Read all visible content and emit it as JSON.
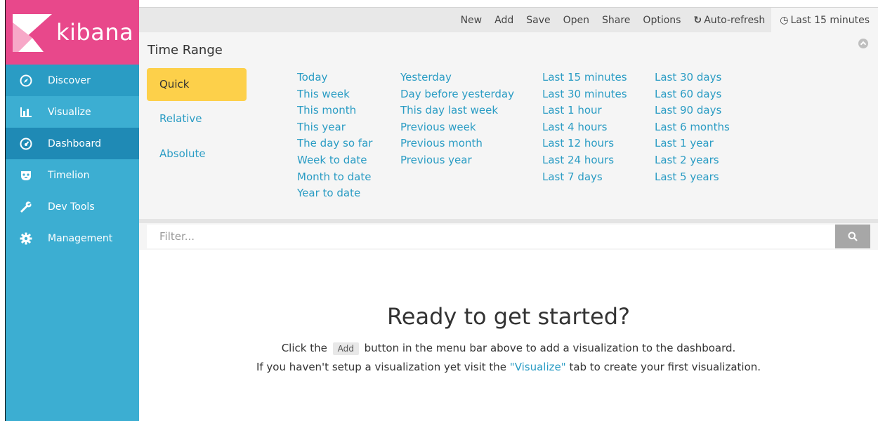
{
  "app": {
    "name": "kibana",
    "brand_color": "#e8488b",
    "sidebar_color": "#3caed2"
  },
  "sidebar": {
    "items": [
      {
        "label": "Discover",
        "icon": "compass-icon"
      },
      {
        "label": "Visualize",
        "icon": "bar-chart-icon"
      },
      {
        "label": "Dashboard",
        "icon": "dashboard-gauge-icon"
      },
      {
        "label": "Timelion",
        "icon": "timelion-mask-icon"
      },
      {
        "label": "Dev Tools",
        "icon": "wrench-icon"
      },
      {
        "label": "Management",
        "icon": "gear-icon"
      }
    ]
  },
  "topbar": {
    "new": "New",
    "add": "Add",
    "save": "Save",
    "open": "Open",
    "share": "Share",
    "options": "Options",
    "auto_refresh": "Auto-refresh",
    "time": "Last 15 minutes"
  },
  "time_panel": {
    "title": "Time Range",
    "tabs": [
      "Quick",
      "Relative",
      "Absolute"
    ],
    "active_tab": "Quick",
    "accent_color": "#fdd04a",
    "columns": [
      [
        "Today",
        "This week",
        "This month",
        "This year",
        "The day so far",
        "Week to date",
        "Month to date",
        "Year to date"
      ],
      [
        "Yesterday",
        "Day before yesterday",
        "This day last week",
        "Previous week",
        "Previous month",
        "Previous year"
      ],
      [
        "Last 15 minutes",
        "Last 30 minutes",
        "Last 1 hour",
        "Last 4 hours",
        "Last 12 hours",
        "Last 24 hours",
        "Last 7 days"
      ],
      [
        "Last 30 days",
        "Last 60 days",
        "Last 90 days",
        "Last 6 months",
        "Last 1 year",
        "Last 2 years",
        "Last 5 years"
      ]
    ]
  },
  "filter": {
    "placeholder": "Filter..."
  },
  "main": {
    "title": "Ready to get started?",
    "line1_pre": "Click the",
    "add_chip": "Add",
    "line1_post": "button in the menu bar above to add a visualization to the dashboard.",
    "line2_pre": "If you haven't setup a visualization yet visit the",
    "line2_link": "\"Visualize\"",
    "line2_post": "tab to create your first visualization."
  }
}
